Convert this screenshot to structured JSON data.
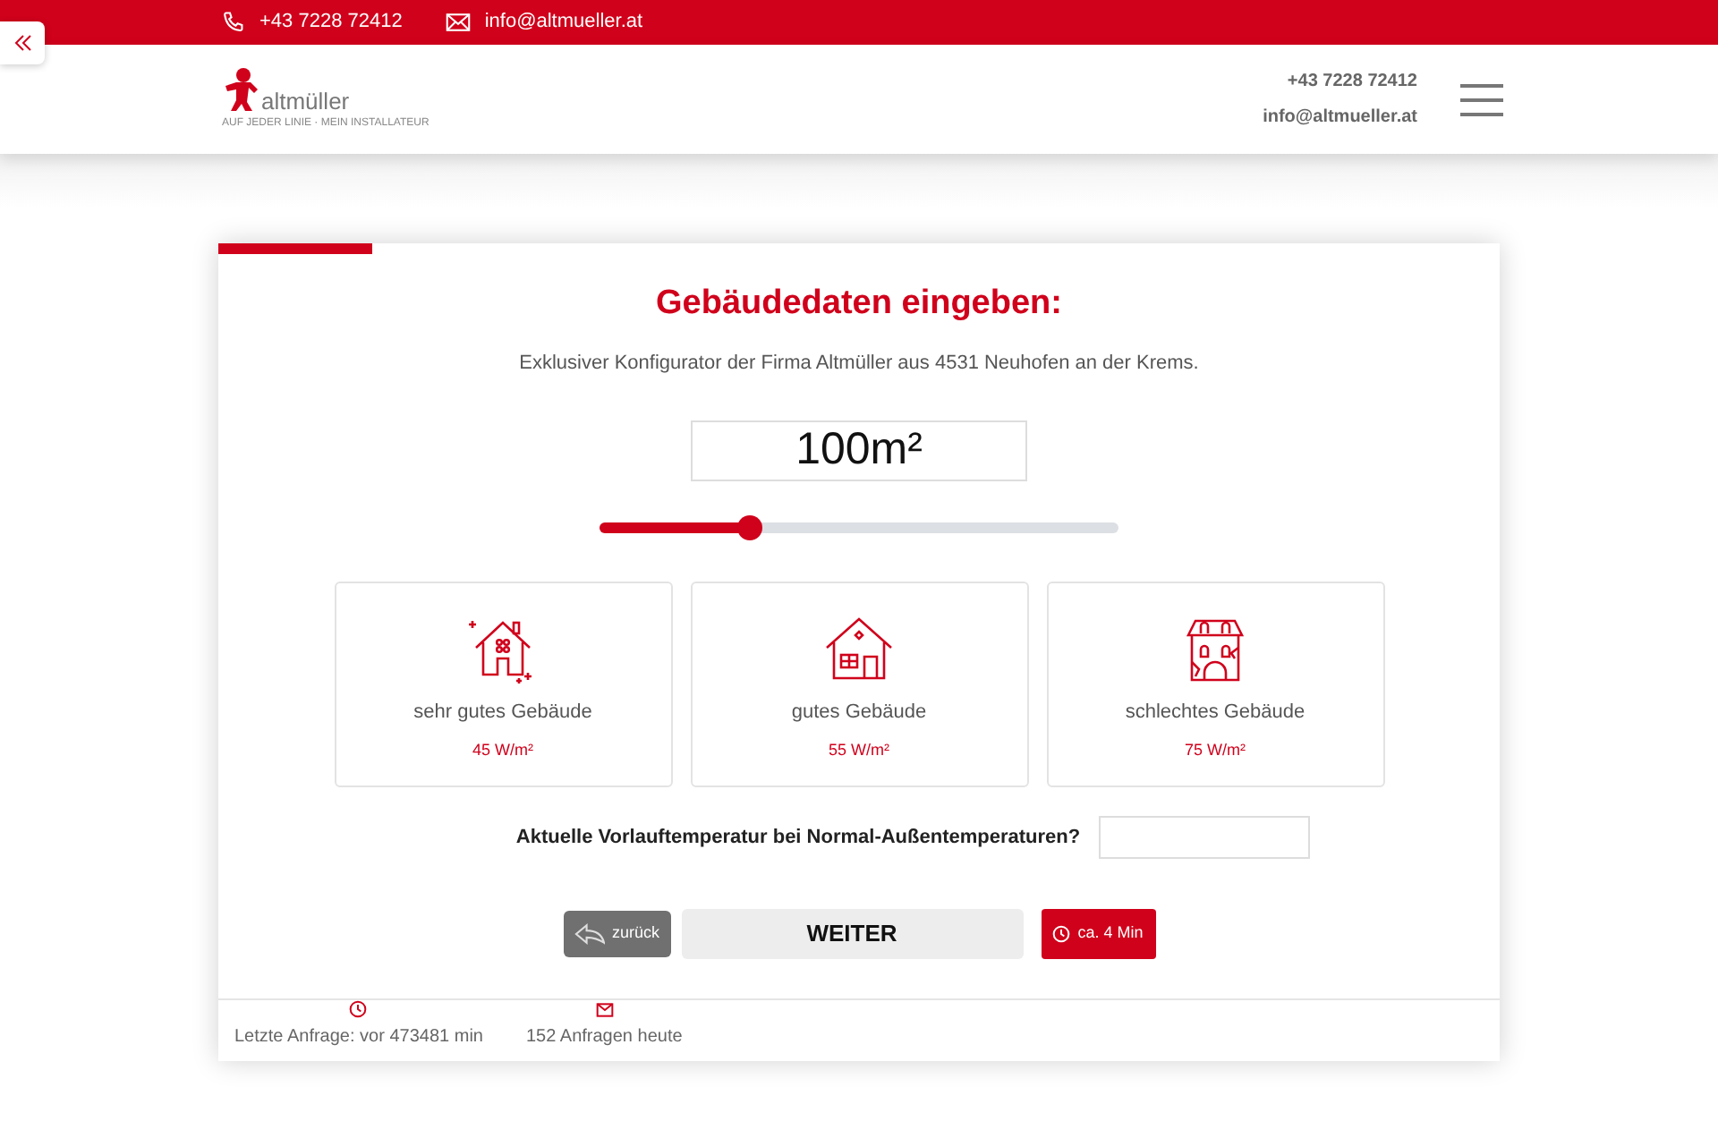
{
  "topbar": {
    "phone": "+43 7228 72412",
    "email": "info@altmueller.at"
  },
  "header": {
    "logo_text": "altmüller",
    "logo_tagline": "AUF JEDER LINIE · MEIN INSTALLATEUR",
    "phone": "+43 7228 72412",
    "email": "info@altmueller.at"
  },
  "form": {
    "progress": {
      "level": 0.12
    },
    "title": "Gebäudedaten eingeben:",
    "subtitle": "Exklusiver Konfigurator der Firma Altmüller aus 4531 Neuhofen an der Krems.",
    "area": {
      "value": "100m²",
      "level": 0.29
    },
    "options": [
      {
        "kind": "sparkle",
        "label": "sehr gutes Gebäude",
        "value": "45 W/m²",
        "selected": false
      },
      {
        "kind": "house",
        "label": "gutes Gebäude",
        "value": "55 W/m²",
        "selected": false
      },
      {
        "kind": "old",
        "label": "schlechtes Gebäude",
        "value": "75 W/m²",
        "selected": false
      }
    ],
    "question": "Aktuelle Vorlauftemperatur bei Normal-Außentemperaturen?",
    "buttons": {
      "back": "zurück",
      "next": "WEITER",
      "time": "ca. 4 Min"
    },
    "footer": [
      {
        "kind": "clock",
        "text": "Letzte Anfrage: vor 473481 min"
      },
      {
        "kind": "mail",
        "text": "152 Anfragen heute"
      }
    ]
  }
}
